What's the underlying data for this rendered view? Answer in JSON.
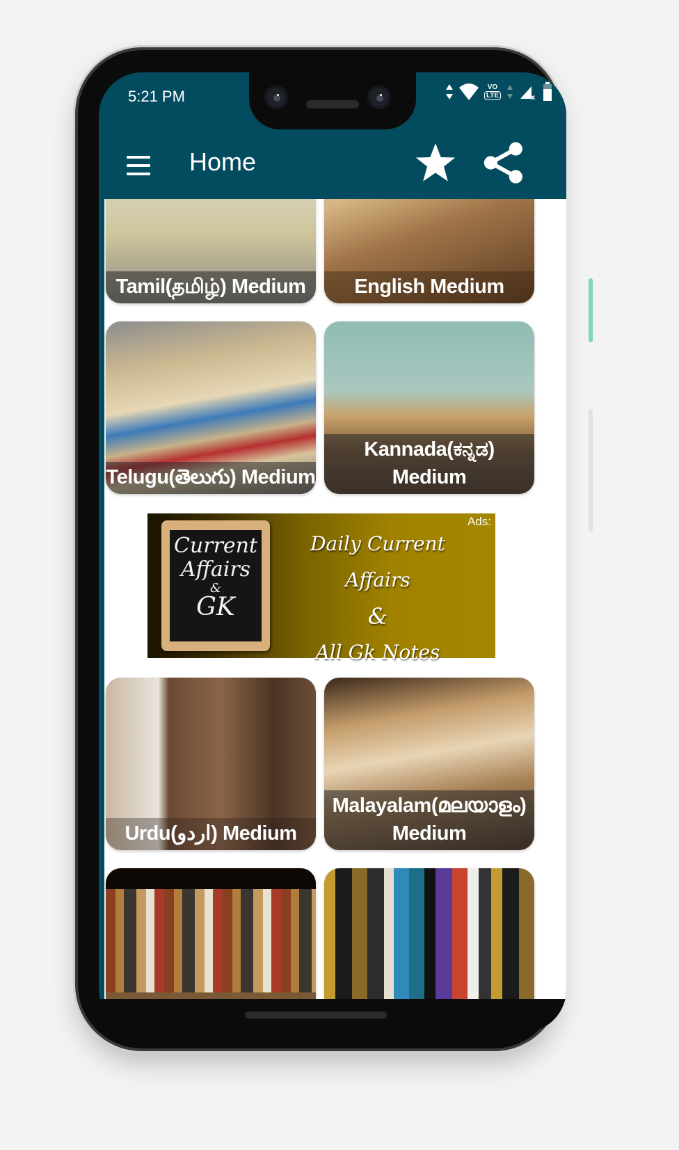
{
  "status_bar": {
    "time": "5:21 PM",
    "icons": [
      "data-arrows-icon",
      "wifi-icon",
      "volte-icon",
      "signal-icon",
      "battery-icon"
    ],
    "volte_label": "VO",
    "lte_label": "LTE"
  },
  "app_bar": {
    "title": "Home",
    "menu_icon": "hamburger-menu-icon",
    "actions": [
      "star-icon",
      "share-icon"
    ]
  },
  "colors": {
    "primary": "#034b5e",
    "ad_gold": "#a58600"
  },
  "cards": [
    {
      "label": "Tamil(தமிழ்) Medium"
    },
    {
      "label": "English Medium"
    },
    {
      "label": "Telugu(తెలుగు) Medium"
    },
    {
      "label": "Kannada(ಕನ್ನಡ) Medium"
    },
    {
      "label": "Urdu(اردو) Medium"
    },
    {
      "label": "Malayalam(മലയാളം) Medium"
    },
    {
      "label": ""
    },
    {
      "label": ""
    }
  ],
  "ad": {
    "badge": "Ads:",
    "board_line1": "Current",
    "board_line2": "Affairs",
    "board_line3": "&",
    "board_line4": "GK",
    "headline1": "Daily Current Affairs",
    "headline2": "&",
    "headline3": "All Gk Notes"
  }
}
